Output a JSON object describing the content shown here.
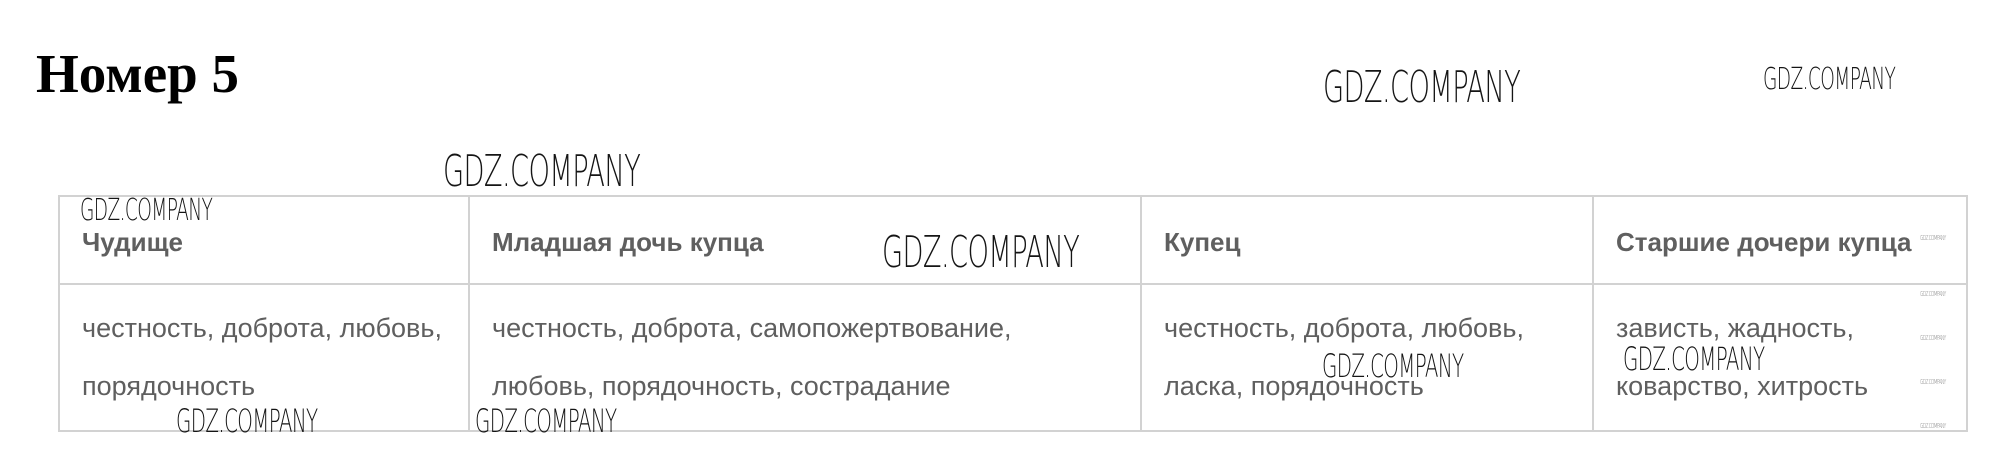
{
  "title": "Номер 5",
  "table": {
    "headers": [
      "Чудище",
      "Младшая дочь купца",
      "Купец",
      "Старшие дочери купца"
    ],
    "rows": [
      [
        [
          "честность, доброта, любовь,",
          "порядочность"
        ],
        [
          "честность, доброта, самопожертвование,",
          "любовь, порядочность, сострадание"
        ],
        [
          "честность, доброта, любовь,",
          "ласка, порядочность"
        ],
        [
          "зависть, жадность,",
          "коварство, хитрость"
        ]
      ]
    ]
  },
  "watermark": "GDZ.COMPANY"
}
